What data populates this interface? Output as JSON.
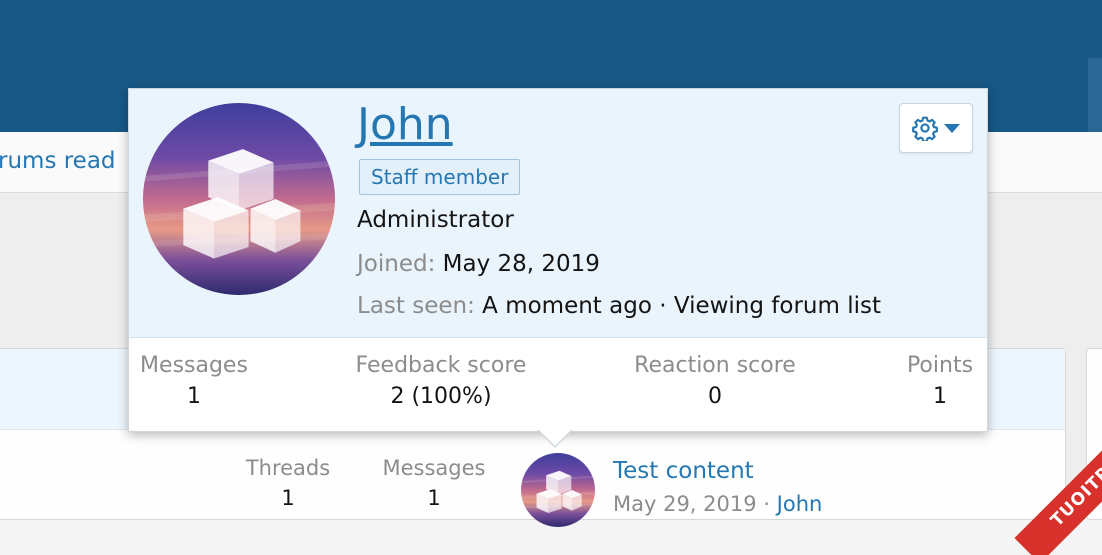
{
  "nav": {
    "link_label": "rums read"
  },
  "node": {
    "stats": [
      {
        "label": "Threads",
        "value": "1"
      },
      {
        "label": "Messages",
        "value": "1"
      }
    ],
    "latest_title": "Test content",
    "latest_date": "May 29, 2019",
    "latest_separator": "·",
    "latest_author": "John"
  },
  "tooltip": {
    "username": "John",
    "badge": "Staff member",
    "user_title": "Administrator",
    "joined_label": "Joined:",
    "joined_value": "May 28, 2019",
    "last_seen_label": "Last seen:",
    "last_seen_value": "A moment ago · Viewing forum list",
    "menu_icon": "gear-icon",
    "stats": [
      {
        "label": "Messages",
        "value": "1"
      },
      {
        "label": "Feedback score",
        "value": "2 (100%)"
      },
      {
        "label": "Reaction score",
        "value": "0"
      },
      {
        "label": "Points",
        "value": "1"
      }
    ]
  },
  "watermark": {
    "text": "TUOITREIT.VN"
  },
  "colors": {
    "header": "#185886",
    "link": "#2577b1",
    "muted": "#8c8c8c",
    "tooltip_top": "#eaf4fc"
  }
}
